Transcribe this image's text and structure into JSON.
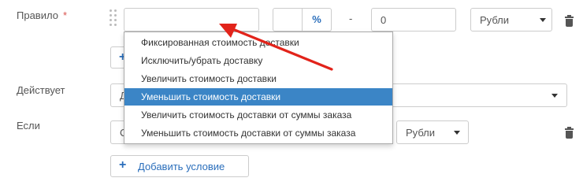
{
  "form": {
    "rule": {
      "label": "Правило",
      "required_mark": "*",
      "name_value": "",
      "percent_value": "",
      "percent_addon": "%",
      "range_separator": "-",
      "amount_value": "0",
      "currency_selected": "Рубли"
    },
    "acts": {
      "label": "Действует",
      "select_value_partial": "Д"
    },
    "if": {
      "label": "Если",
      "first_value_partial": "С",
      "currency_selected": "Рубли"
    },
    "add_condition_button_label": "Добавить условие"
  },
  "dropdown": {
    "options": [
      "Фиксированная стоимость доставки",
      "Исключить/убрать доставку",
      "Увеличить стоимость доставки",
      "Уменьшить стоимость доставки",
      "Увеличить стоимость доставки от суммы заказа",
      "Уменьшить стоимость доставки от суммы заказа"
    ],
    "selected_index": 3
  },
  "colors": {
    "accent": "#3b85c6",
    "annotation_arrow": "#e2231a",
    "required": "#d9534f"
  }
}
